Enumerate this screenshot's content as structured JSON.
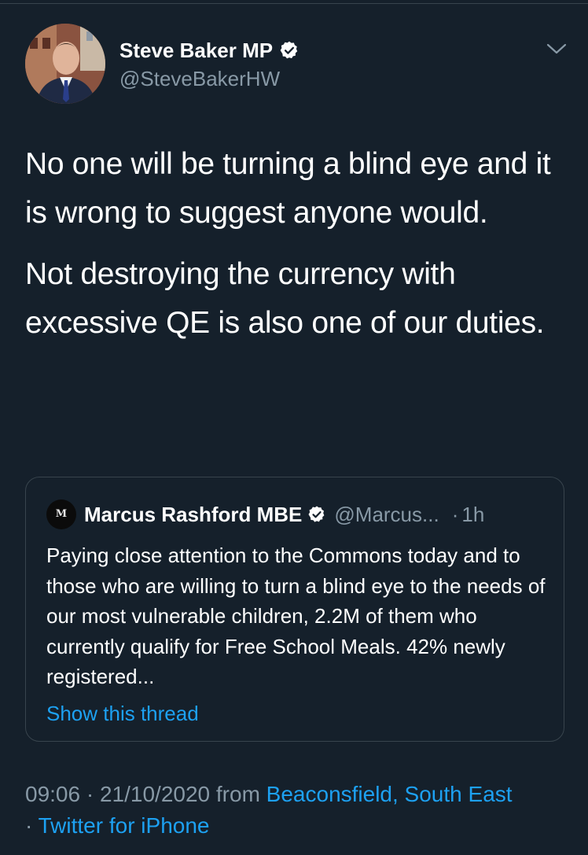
{
  "header": {
    "display_name": "Steve Baker MP",
    "handle": "@SteveBakerHW"
  },
  "tweet": {
    "paragraphs": [
      "No one will be turning a blind eye and it is wrong to suggest anyone would.",
      "Not destroying the currency with excessive QE is also one of our duties."
    ]
  },
  "quote": {
    "avatar_text": "M",
    "display_name": "Marcus Rashford MBE",
    "handle": "@Marcus...",
    "separator": "·",
    "time": "1h",
    "text": "Paying close attention to the Commons today and to those who are willing to turn a blind eye to the needs of our most vulnerable children, 2.2M of them who currently qualify for Free School Meals. 42% newly registered...",
    "show_thread": "Show this thread"
  },
  "meta": {
    "time": "09:06",
    "sep1": " · ",
    "date": "21/10/2020",
    "from": " from ",
    "location": "Beaconsfield, South East",
    "sep2": "· ",
    "source": "Twitter for iPhone"
  },
  "colors": {
    "background": "#15202b",
    "link": "#1da1f2",
    "secondary_text": "#8899a6",
    "border": "#38444d"
  },
  "icons": [
    "verified-badge-icon",
    "chevron-down-icon"
  ]
}
